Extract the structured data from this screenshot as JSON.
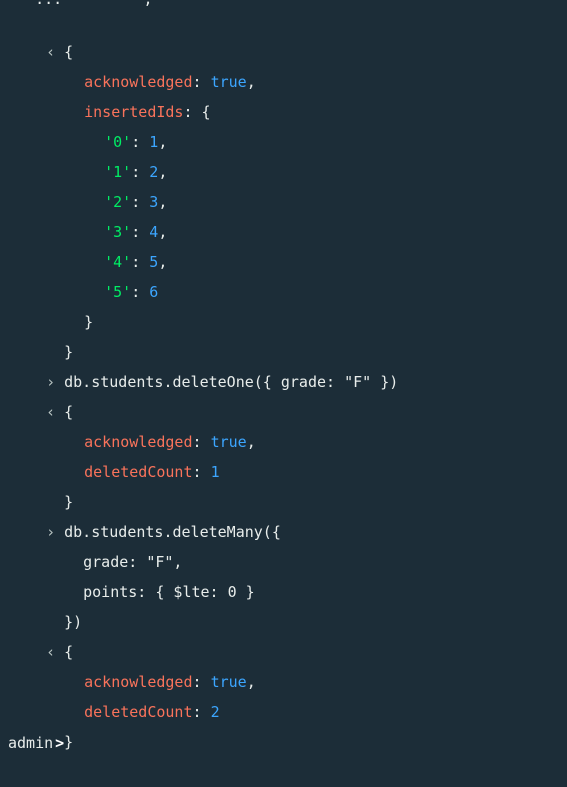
{
  "top_fragment": "'  ...         ;",
  "output1": {
    "open": "{",
    "ack_key": "acknowledged",
    "ack_val": "true",
    "ids_key": "insertedIds",
    "ids": [
      {
        "key": "'0'",
        "val": "1",
        "comma": ","
      },
      {
        "key": "'1'",
        "val": "2",
        "comma": ","
      },
      {
        "key": "'2'",
        "val": "3",
        "comma": ","
      },
      {
        "key": "'3'",
        "val": "4",
        "comma": ","
      },
      {
        "key": "'4'",
        "val": "5",
        "comma": ","
      },
      {
        "key": "'5'",
        "val": "6",
        "comma": ""
      }
    ],
    "close_inner": "}",
    "close": "}"
  },
  "command1": "db.students.deleteOne({ grade: \"F\" })",
  "output2": {
    "open": "{",
    "ack_key": "acknowledged",
    "ack_val": "true",
    "count_key": "deletedCount",
    "count_val": "1",
    "close": "}"
  },
  "command2": {
    "line1": "db.students.deleteMany({",
    "line2": "grade: \"F\",",
    "line3": "points: { $lte: 0 }",
    "line4": "})"
  },
  "output3": {
    "open": "{",
    "ack_key": "acknowledged",
    "ack_val": "true",
    "count_key": "deletedCount",
    "count_val": "2",
    "close": "}"
  },
  "prompt": {
    "db_name": "admin",
    "caret": ">"
  },
  "icons": {
    "output": "chevron-left-icon",
    "input": "chevron-right-icon"
  },
  "colors": {
    "background": "#1c2d38",
    "key": "#f9735b",
    "boolean_number": "#3ca6ff",
    "string": "#00ed64",
    "text": "#e8edeb"
  }
}
